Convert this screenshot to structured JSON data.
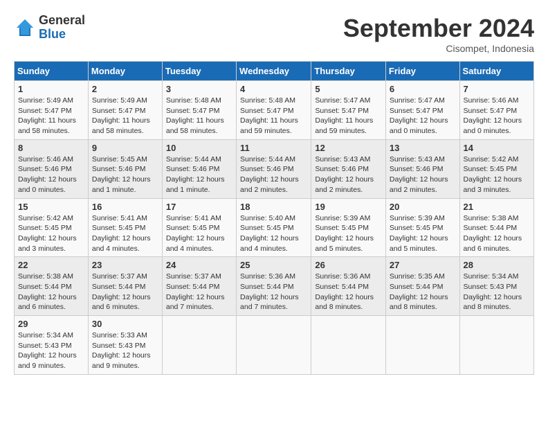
{
  "logo": {
    "line1": "General",
    "line2": "Blue"
  },
  "title": "September 2024",
  "subtitle": "Cisompet, Indonesia",
  "days_of_week": [
    "Sunday",
    "Monday",
    "Tuesday",
    "Wednesday",
    "Thursday",
    "Friday",
    "Saturday"
  ],
  "weeks": [
    [
      {
        "day": 1,
        "detail": "Sunrise: 5:49 AM\nSunset: 5:47 PM\nDaylight: 11 hours\nand 58 minutes."
      },
      {
        "day": 2,
        "detail": "Sunrise: 5:49 AM\nSunset: 5:47 PM\nDaylight: 11 hours\nand 58 minutes."
      },
      {
        "day": 3,
        "detail": "Sunrise: 5:48 AM\nSunset: 5:47 PM\nDaylight: 11 hours\nand 58 minutes."
      },
      {
        "day": 4,
        "detail": "Sunrise: 5:48 AM\nSunset: 5:47 PM\nDaylight: 11 hours\nand 59 minutes."
      },
      {
        "day": 5,
        "detail": "Sunrise: 5:47 AM\nSunset: 5:47 PM\nDaylight: 11 hours\nand 59 minutes."
      },
      {
        "day": 6,
        "detail": "Sunrise: 5:47 AM\nSunset: 5:47 PM\nDaylight: 12 hours\nand 0 minutes."
      },
      {
        "day": 7,
        "detail": "Sunrise: 5:46 AM\nSunset: 5:47 PM\nDaylight: 12 hours\nand 0 minutes."
      }
    ],
    [
      {
        "day": 8,
        "detail": "Sunrise: 5:46 AM\nSunset: 5:46 PM\nDaylight: 12 hours\nand 0 minutes."
      },
      {
        "day": 9,
        "detail": "Sunrise: 5:45 AM\nSunset: 5:46 PM\nDaylight: 12 hours\nand 1 minute."
      },
      {
        "day": 10,
        "detail": "Sunrise: 5:44 AM\nSunset: 5:46 PM\nDaylight: 12 hours\nand 1 minute."
      },
      {
        "day": 11,
        "detail": "Sunrise: 5:44 AM\nSunset: 5:46 PM\nDaylight: 12 hours\nand 2 minutes."
      },
      {
        "day": 12,
        "detail": "Sunrise: 5:43 AM\nSunset: 5:46 PM\nDaylight: 12 hours\nand 2 minutes."
      },
      {
        "day": 13,
        "detail": "Sunrise: 5:43 AM\nSunset: 5:46 PM\nDaylight: 12 hours\nand 2 minutes."
      },
      {
        "day": 14,
        "detail": "Sunrise: 5:42 AM\nSunset: 5:45 PM\nDaylight: 12 hours\nand 3 minutes."
      }
    ],
    [
      {
        "day": 15,
        "detail": "Sunrise: 5:42 AM\nSunset: 5:45 PM\nDaylight: 12 hours\nand 3 minutes."
      },
      {
        "day": 16,
        "detail": "Sunrise: 5:41 AM\nSunset: 5:45 PM\nDaylight: 12 hours\nand 4 minutes."
      },
      {
        "day": 17,
        "detail": "Sunrise: 5:41 AM\nSunset: 5:45 PM\nDaylight: 12 hours\nand 4 minutes."
      },
      {
        "day": 18,
        "detail": "Sunrise: 5:40 AM\nSunset: 5:45 PM\nDaylight: 12 hours\nand 4 minutes."
      },
      {
        "day": 19,
        "detail": "Sunrise: 5:39 AM\nSunset: 5:45 PM\nDaylight: 12 hours\nand 5 minutes."
      },
      {
        "day": 20,
        "detail": "Sunrise: 5:39 AM\nSunset: 5:45 PM\nDaylight: 12 hours\nand 5 minutes."
      },
      {
        "day": 21,
        "detail": "Sunrise: 5:38 AM\nSunset: 5:44 PM\nDaylight: 12 hours\nand 6 minutes."
      }
    ],
    [
      {
        "day": 22,
        "detail": "Sunrise: 5:38 AM\nSunset: 5:44 PM\nDaylight: 12 hours\nand 6 minutes."
      },
      {
        "day": 23,
        "detail": "Sunrise: 5:37 AM\nSunset: 5:44 PM\nDaylight: 12 hours\nand 6 minutes."
      },
      {
        "day": 24,
        "detail": "Sunrise: 5:37 AM\nSunset: 5:44 PM\nDaylight: 12 hours\nand 7 minutes."
      },
      {
        "day": 25,
        "detail": "Sunrise: 5:36 AM\nSunset: 5:44 PM\nDaylight: 12 hours\nand 7 minutes."
      },
      {
        "day": 26,
        "detail": "Sunrise: 5:36 AM\nSunset: 5:44 PM\nDaylight: 12 hours\nand 8 minutes."
      },
      {
        "day": 27,
        "detail": "Sunrise: 5:35 AM\nSunset: 5:44 PM\nDaylight: 12 hours\nand 8 minutes."
      },
      {
        "day": 28,
        "detail": "Sunrise: 5:34 AM\nSunset: 5:43 PM\nDaylight: 12 hours\nand 8 minutes."
      }
    ],
    [
      {
        "day": 29,
        "detail": "Sunrise: 5:34 AM\nSunset: 5:43 PM\nDaylight: 12 hours\nand 9 minutes."
      },
      {
        "day": 30,
        "detail": "Sunrise: 5:33 AM\nSunset: 5:43 PM\nDaylight: 12 hours\nand 9 minutes."
      },
      null,
      null,
      null,
      null,
      null
    ]
  ]
}
